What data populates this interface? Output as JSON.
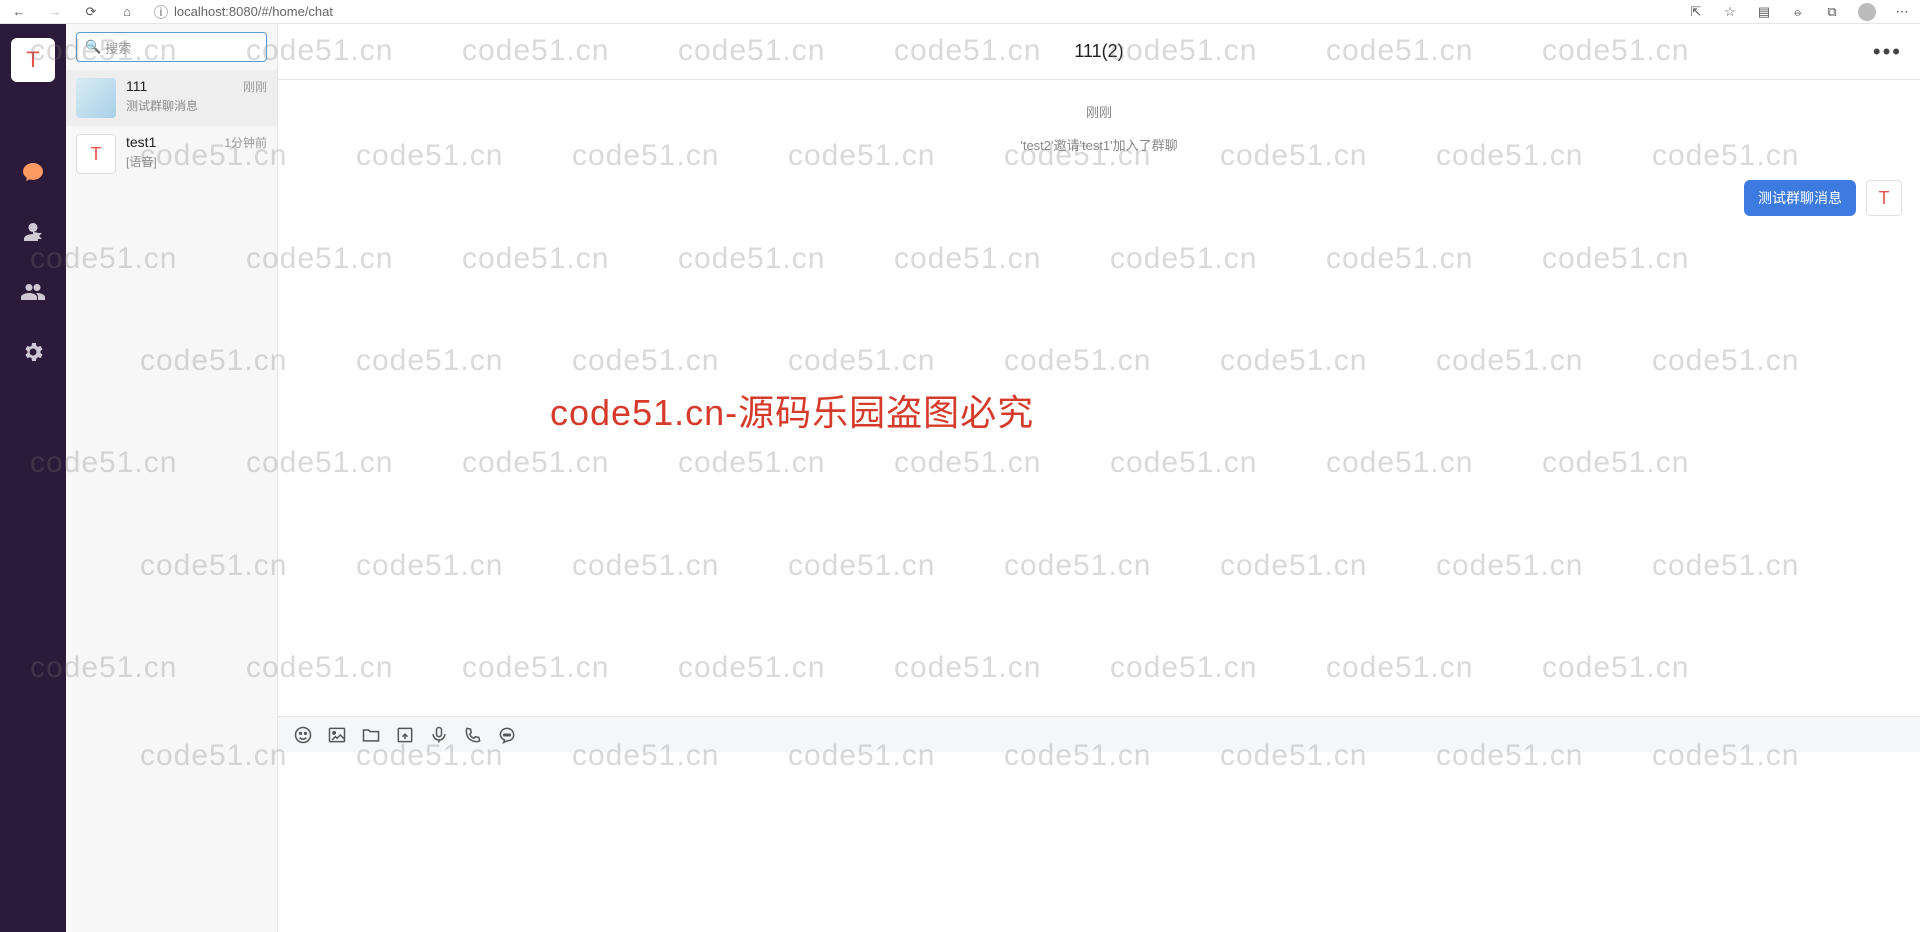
{
  "browser": {
    "url": "localhost:8080/#/home/chat"
  },
  "nav": {
    "avatar_letter": "T"
  },
  "search": {
    "placeholder": "搜索"
  },
  "conversations": [
    {
      "name": "111",
      "time": "刚刚",
      "preview": "测试群聊消息",
      "avatar_letter": ""
    },
    {
      "name": "test1",
      "time": "1分钟前",
      "preview": "[语音]",
      "avatar_letter": "T"
    }
  ],
  "chat": {
    "title": "111(2)",
    "time_label": "刚刚",
    "system_message": "'test2'邀请'test1'加入了群聊",
    "message_text": "测试群聊消息",
    "my_avatar_letter": "T"
  },
  "watermark": {
    "cell": "code51.cn",
    "center": "code51.cn-源码乐园盗图必究"
  }
}
